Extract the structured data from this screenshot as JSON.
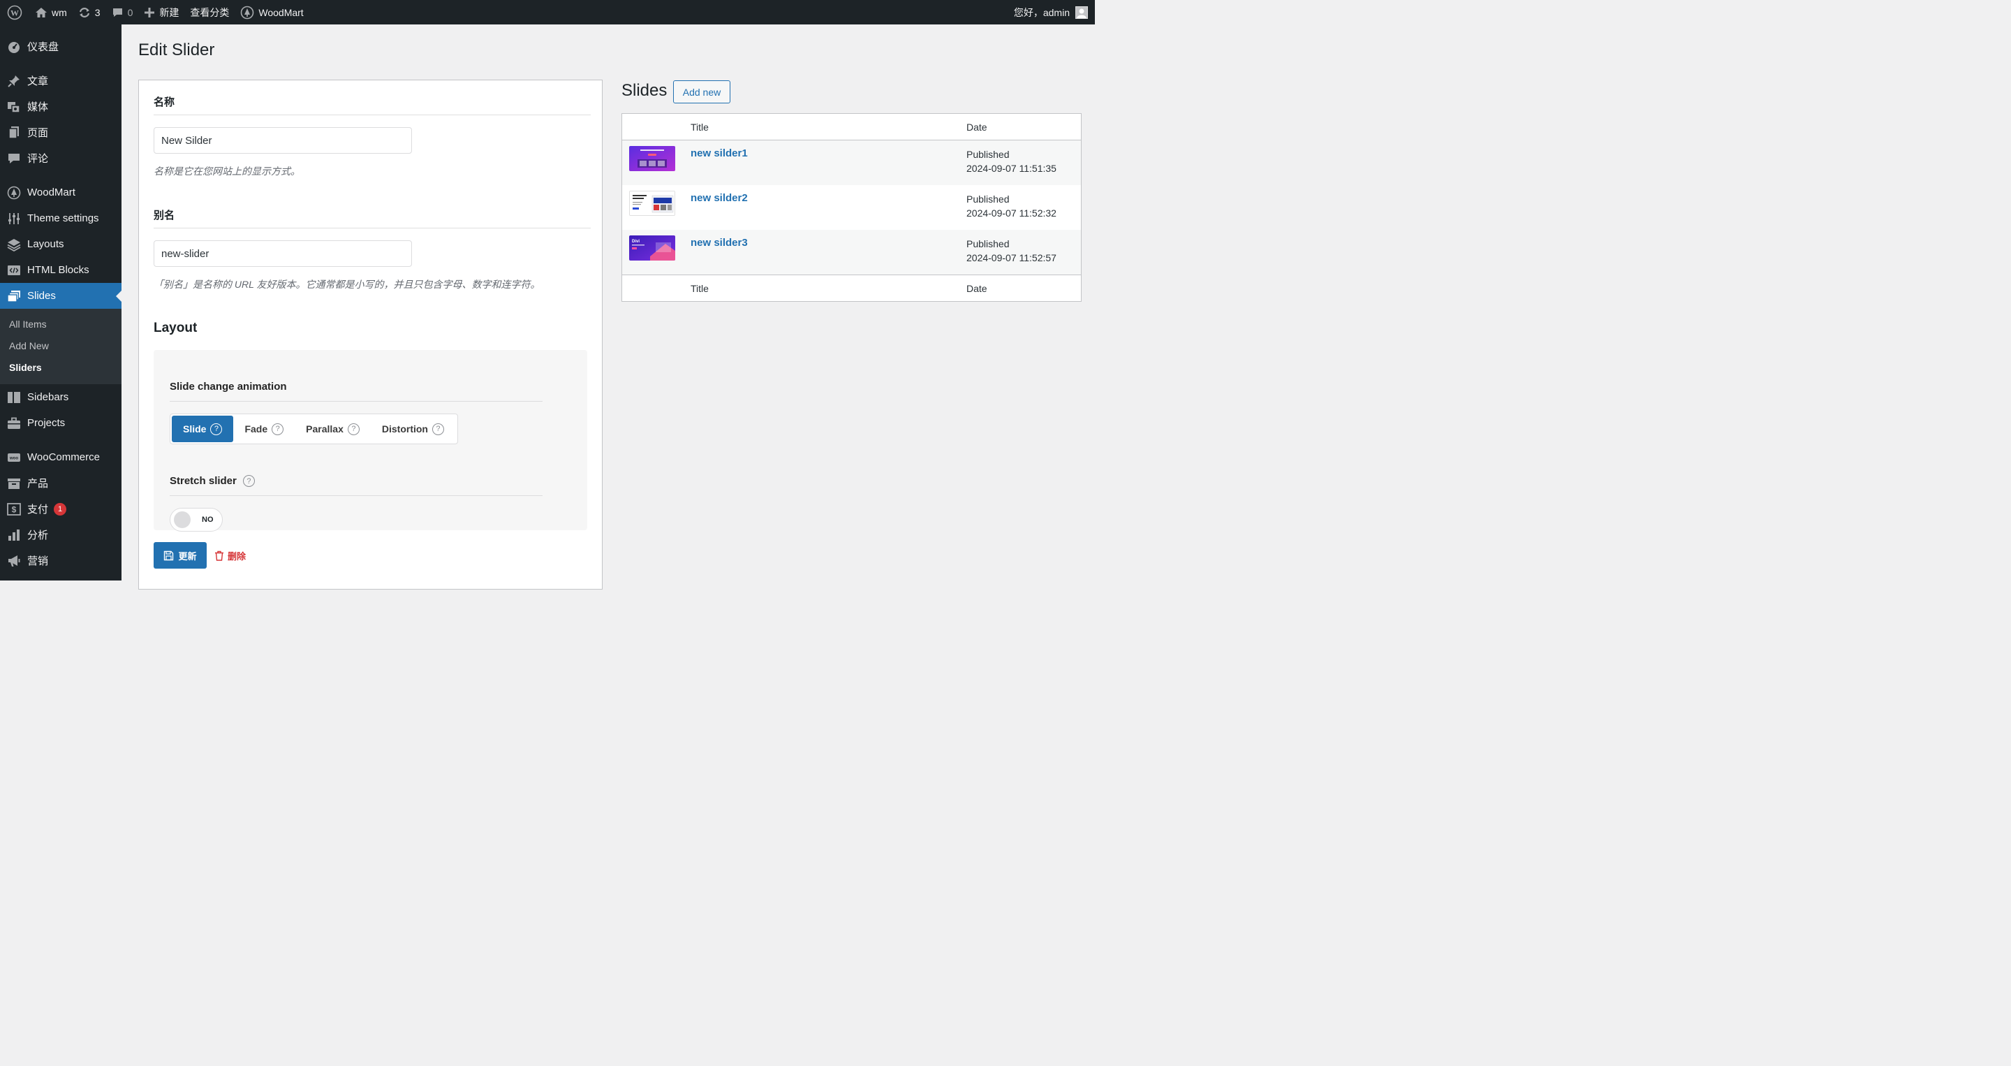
{
  "adminbar": {
    "site_name": "wm",
    "updates_count": "3",
    "comments_count": "0",
    "new_label": "新建",
    "view_category": "查看分类",
    "woodmart_label": "WoodMart",
    "greeting": "您好，admin"
  },
  "sidebar": {
    "dashboard": "仪表盘",
    "posts": "文章",
    "media": "媒体",
    "pages": "页面",
    "comments": "评论",
    "woodmart": "WoodMart",
    "theme_settings": "Theme settings",
    "layouts": "Layouts",
    "html_blocks": "HTML Blocks",
    "slides": "Slides",
    "sub_all_items": "All Items",
    "sub_add_new": "Add New",
    "sub_sliders": "Sliders",
    "sidebars": "Sidebars",
    "projects": "Projects",
    "woocommerce": "WooCommerce",
    "products": "产品",
    "payments": "支付",
    "payments_badge": "1",
    "analytics": "分析",
    "marketing": "营销"
  },
  "page": {
    "title": "Edit Slider"
  },
  "form": {
    "name_label": "名称",
    "name_value": "New Silder",
    "name_desc": "名称是它在您网站上的显示方式。",
    "slug_label": "别名",
    "slug_value": "new-slider",
    "slug_desc": "「别名」是名称的 URL 友好版本。它通常都是小写的，并且只包含字母、数字和连字符。",
    "layout_title": "Layout",
    "animation_label": "Slide change animation",
    "animation_options": [
      "Slide",
      "Fade",
      "Parallax",
      "Distortion"
    ],
    "animation_selected": "Slide",
    "stretch_label": "Stretch slider",
    "stretch_value": "NO",
    "update_label": "更新",
    "delete_label": "删除"
  },
  "slides": {
    "title": "Slides",
    "add_new": "Add new",
    "col_title": "Title",
    "col_date": "Date",
    "rows": [
      {
        "title": "new silder1",
        "status": "Published",
        "date": "2024-09-07 11:51:35"
      },
      {
        "title": "new silder2",
        "status": "Published",
        "date": "2024-09-07 11:52:32"
      },
      {
        "title": "new silder3",
        "status": "Published",
        "date": "2024-09-07 11:52:57"
      }
    ]
  },
  "colors": {
    "admin_dark": "#1d2327",
    "accent_blue": "#2271b1",
    "danger_red": "#d63638"
  }
}
